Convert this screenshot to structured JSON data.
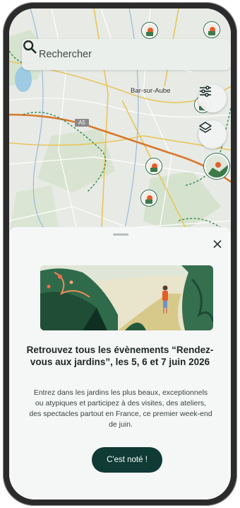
{
  "search": {
    "placeholder": "Rechercher"
  },
  "map": {
    "city_label": "Bar-sur-Aube",
    "road_label": "A5"
  },
  "sheet": {
    "title": "Retrouvez tous les évènements “Rendez-vous aux jardins”, les 5, 6 et 7 juin 2026",
    "body": "Entrez dans les jardins les plus beaux, exceptionnels ou atypiques et participez à des visites, des ateliers, des spectacles partout en France, ce premier week-end de juin.",
    "cta_label": "C'est noté !"
  },
  "colors": {
    "primary": "#0f3a35",
    "marker_ring": "#2e6b4f",
    "road_orange": "#d9772b",
    "border_green": "#2f8a4a"
  },
  "icons": [
    "search-icon",
    "filter-icon",
    "layers-icon",
    "close-icon"
  ]
}
